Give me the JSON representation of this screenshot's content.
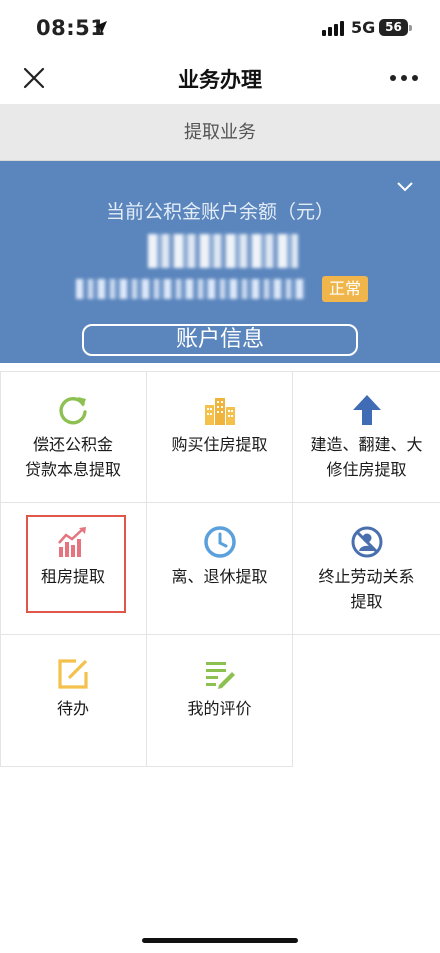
{
  "status_bar": {
    "time": "08:51",
    "network": "5G",
    "battery": "56"
  },
  "nav": {
    "title": "业务办理"
  },
  "section": {
    "title": "提取业务"
  },
  "balance_card": {
    "caption": "当前公积金账户余额（元）",
    "status_badge": "正常",
    "account_button": "账户信息",
    "background_color": "#5b86bd"
  },
  "services": [
    {
      "label_line1": "偿还公积金",
      "label_line2": "贷款本息提取",
      "icon": "refresh-icon",
      "color": "#8cc152"
    },
    {
      "label_line1": "购买住房提取",
      "label_line2": "",
      "icon": "buildings-icon",
      "color": "#f3c14c"
    },
    {
      "label_line1": "建造、翻建、大",
      "label_line2": "修住房提取",
      "icon": "arrow-up-icon",
      "color": "#3f6cb4"
    },
    {
      "label_line1": "租房提取",
      "label_line2": "",
      "icon": "rent-chart-icon",
      "color": "#e57480",
      "highlighted": true
    },
    {
      "label_line1": "离、退休提取",
      "label_line2": "",
      "icon": "clock-icon",
      "color": "#5aa0dc"
    },
    {
      "label_line1": "终止劳动关系",
      "label_line2": "提取",
      "icon": "no-person-icon",
      "color": "#4a6fae"
    },
    {
      "label_line1": "待办",
      "label_line2": "",
      "icon": "edit-square-icon",
      "color": "#f3c14c"
    },
    {
      "label_line1": "我的评价",
      "label_line2": "",
      "icon": "list-pencil-icon",
      "color": "#8cc152"
    }
  ]
}
